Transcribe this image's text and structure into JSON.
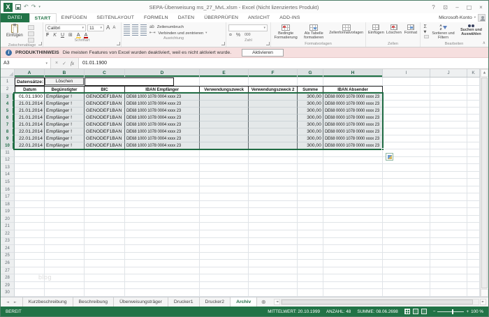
{
  "icons": {
    "undo": "↶",
    "redo": "↷",
    "dropdown": "▾",
    "small_down": "▼",
    "up": "▲",
    "left": "◄",
    "right": "►",
    "check": "✓",
    "cancel": "×",
    "help": "?",
    "minimize": "–",
    "maximize": "□",
    "close": "×",
    "ribbon_options": "⊡",
    "collapse": "∧",
    "add_sheet": "⊕",
    "info": "i",
    "fx": "fx",
    "sigma": "Σ",
    "border_grid": "⊞",
    "font_color_letter": "A",
    "fill_letter": "A",
    "grow_font": "A",
    "shrink_font": "A"
  },
  "title_bar": {
    "title": "SEPA-Überweisung ms_27_MvL.xlsm - Excel (Nicht lizenziertes Produkt)"
  },
  "ribbon_tabs": {
    "items": [
      "DATEI",
      "START",
      "EINFÜGEN",
      "SEITENLAYOUT",
      "FORMELN",
      "DATEN",
      "ÜBERPRÜFEN",
      "ANSICHT",
      "ADD-INS"
    ],
    "active": "START",
    "account_label": "Microsoft-Konto"
  },
  "ribbon": {
    "clipboard": {
      "group": "Zwischenablage",
      "paste": "Einfügen"
    },
    "font": {
      "group": "Schriftart",
      "family": "Calibri",
      "size": "11",
      "bold": "F",
      "italic": "K",
      "underline": "U"
    },
    "alignment": {
      "group": "Ausrichtung",
      "wrap": "Zeilenumbruch",
      "merge": "Verbinden und zentrieren"
    },
    "number": {
      "group": "Zahl",
      "currency": "¤",
      "percent": "%",
      "thousands": "000"
    },
    "styles": {
      "group": "Formatvorlagen",
      "conditional": "Bedingte Formatierung",
      "as_table": "Als Tabelle formatieren",
      "cell_styles": "Zellenformatvorlagen"
    },
    "cells": {
      "group": "Zellen",
      "insert": "Einfügen",
      "delete": "Löschen",
      "format": "Format"
    },
    "editing": {
      "group": "Bearbeiten",
      "sort": "Sortieren und Filtern",
      "find": "Suchen und Auswählen"
    }
  },
  "notice": {
    "label": "PRODUKTHINWEIS",
    "message": "Die meisten Features von Excel wurden deaktiviert, weil es nicht aktiviert wurde.",
    "action": "Aktivieren"
  },
  "formula_bar": {
    "name_box": "A3",
    "value": "01.01.1900"
  },
  "sheet": {
    "column_letters": [
      "A",
      "B",
      "C",
      "D",
      "E",
      "F",
      "G",
      "H",
      "I",
      "J",
      "K"
    ],
    "selected_columns": 8,
    "row1": {
      "label": "Datensätze:",
      "button": "Löschen"
    },
    "header_row": [
      "Datum",
      "Begünstigter",
      "BIC",
      "IBAN Empfänger",
      "Verwendungszweck",
      "Verwendungszweck 2",
      "Summe",
      "IBAN Absender"
    ],
    "first_data_row_number": 3,
    "data_rows": [
      [
        "01.01.1900",
        "Empfänger !",
        "GENODEF1BAN",
        "DE68 1000 1078 0004 xxxx 23",
        "",
        "",
        "300,00",
        "DE68 0000 1078 0000 xxxx 23"
      ],
      [
        "21.01.2014",
        "Empfänger !",
        "GENODEF1BAN",
        "DE68 1000 1078 0004 xxxx 23",
        "",
        "",
        "300,00",
        "DE68 0000 1078 0000 xxxx 23"
      ],
      [
        "21.01.2014",
        "Empfänger !",
        "GENODEF1BAN",
        "DE68 1000 1078 0004 xxxx 23",
        "",
        "",
        "300,00",
        "DE68 0000 1078 0000 xxxx 23"
      ],
      [
        "21.01.2014",
        "Empfänger !",
        "GENODEF1BAN",
        "DE68 1000 1078 0004 xxxx 23",
        "",
        "",
        "300,00",
        "DE68 0000 1078 0000 xxxx 23"
      ],
      [
        "21.01.2014",
        "Empfänger !",
        "GENODEF1BAN",
        "DE68 1000 1078 0004 xxxx 23",
        "",
        "",
        "300,00",
        "DE68 0000 1078 0000 xxxx 23"
      ],
      [
        "22.01.2014",
        "Empfänger !",
        "GENODEF1BAN",
        "DE68 1000 1078 0004 xxxx 23",
        "",
        "",
        "300,00",
        "DE68 0000 1078 0000 xxxx 23"
      ],
      [
        "22.01.2014",
        "Empfänger !",
        "GENODEF1BAN",
        "DE68 1000 1078 0004 xxxx 23",
        "",
        "",
        "300,00",
        "DE68 0000 1078 0000 xxxx 23"
      ],
      [
        "22.01.2014",
        "Empfänger !",
        "GENODEF1BAN",
        "DE68 1000 1078 0004 xxxx 23",
        "",
        "",
        "300,00",
        "DE68 0000 1078 0000 xxxx 23"
      ]
    ],
    "empty_rows": {
      "from": 11,
      "to": 30
    },
    "watermark": "blog"
  },
  "sheet_tabs": {
    "items": [
      "Kurzbeschreibung",
      "Beschreibung",
      "Überweisungsträger",
      "Drucker1",
      "Drucker2",
      "Archiv"
    ],
    "active": "Archiv"
  },
  "status_bar": {
    "mode": "BEREIT",
    "aggregates": [
      "MITTELWERT: 20.10.1999",
      "ANZAHL: 48",
      "SUMME: 08.06.2698"
    ],
    "zoom": "100 %"
  }
}
